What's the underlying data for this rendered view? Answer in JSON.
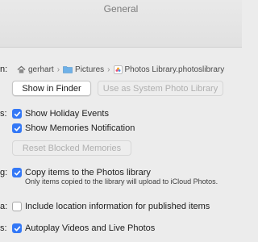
{
  "window": {
    "title": "General"
  },
  "labels": {
    "library": "n:",
    "memories": "s:",
    "importing": "g:",
    "metadata": "a:",
    "autoplay": "s:"
  },
  "path": {
    "items": [
      {
        "label": "gerhart",
        "icon": "home-icon"
      },
      {
        "label": "Pictures",
        "icon": "folder-icon"
      },
      {
        "label": "Photos Library.photoslibrary",
        "icon": "photos-library-icon"
      }
    ],
    "separator": "›"
  },
  "buttons": {
    "show_in_finder": "Show in Finder",
    "use_as_system": "Use as System Photo Library",
    "reset_memories": "Reset Blocked Memories"
  },
  "checkboxes": {
    "holiday": {
      "label": "Show Holiday Events",
      "checked": true
    },
    "memories_notification": {
      "label": "Show Memories Notification",
      "checked": true
    },
    "copy_items": {
      "label": "Copy items to the Photos library",
      "checked": true
    },
    "location": {
      "label": "Include location information for published items",
      "checked": false
    },
    "autoplay": {
      "label": "Autoplay Videos and Live Photos",
      "checked": true
    }
  },
  "notes": {
    "copy_items_note": "Only items copied to the library will upload to iCloud Photos."
  },
  "colors": {
    "accent": "#3478f6"
  }
}
